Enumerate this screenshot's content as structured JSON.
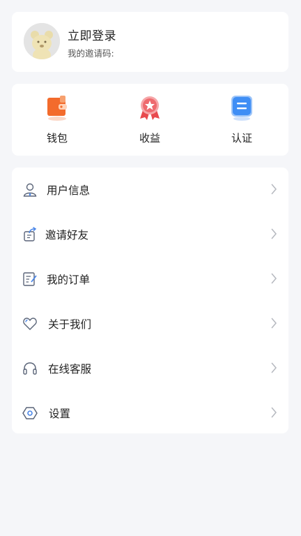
{
  "profile": {
    "title": "立即登录",
    "invite_label": "我的邀请码:"
  },
  "shortcuts": [
    {
      "label": "钱包",
      "icon": "wallet-icon"
    },
    {
      "label": "收益",
      "icon": "medal-icon"
    },
    {
      "label": "认证",
      "icon": "certificate-icon"
    }
  ],
  "menu": [
    {
      "label": "用户信息",
      "icon": "user-icon"
    },
    {
      "label": "邀请好友",
      "icon": "share-icon"
    },
    {
      "label": "我的订单",
      "icon": "order-icon"
    },
    {
      "label": "关于我们",
      "icon": "heart-icon"
    },
    {
      "label": "在线客服",
      "icon": "headset-icon"
    },
    {
      "label": "设置",
      "icon": "settings-icon"
    }
  ],
  "colors": {
    "background": "#f5f6f9",
    "wallet": "#f36b2c",
    "medal": "#e84a4e",
    "certificate": "#3f8ef5",
    "menu_icon": "#5a6478"
  }
}
